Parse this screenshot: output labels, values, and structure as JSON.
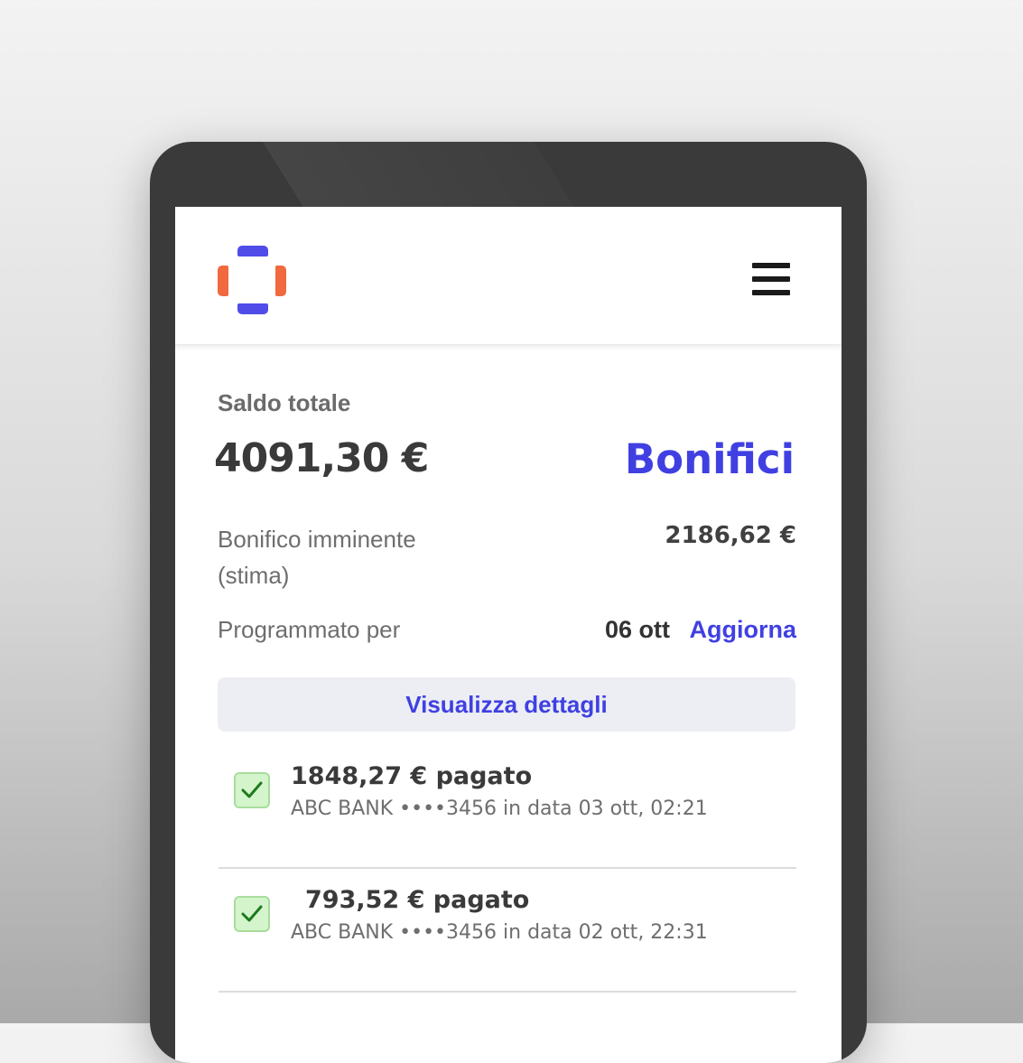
{
  "header": {
    "logo_icon": "brand-logo-icon",
    "menu_icon": "hamburger-menu-icon",
    "brand_colors": {
      "primary": "#4f4ce8",
      "accent": "#f0693f"
    }
  },
  "balance": {
    "label": "Saldo totale",
    "amount": "4091,30 €"
  },
  "section_title": "Bonifici",
  "upcoming": {
    "label": "Bonifico imminente (stima)",
    "amount": "2186,62 €"
  },
  "scheduled": {
    "label": "Programmato per",
    "date": "06 ott",
    "update_label": "Aggiorna"
  },
  "details_button": "Visualizza dettagli",
  "transactions": [
    {
      "amount": "1848,27 € pagato",
      "details": "ABC BANK ••••3456 in data 03 ott, 02:21",
      "status_icon": "checkmark-icon"
    },
    {
      "amount": "793,52 € pagato",
      "details": "ABC BANK ••••3456 in data 02 ott, 22:31",
      "status_icon": "checkmark-icon"
    }
  ],
  "colors": {
    "link": "#4040e2",
    "success_bg": "#d4f4cc",
    "success_check": "#1d7a1d"
  }
}
